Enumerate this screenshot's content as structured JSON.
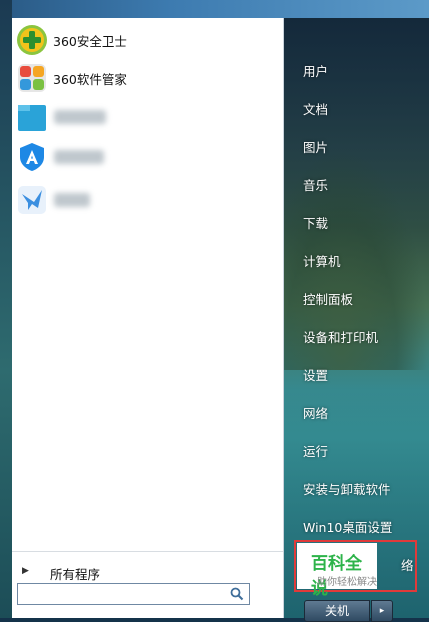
{
  "apps": [
    {
      "label": "360安全卫士",
      "icon": "360-safe-guard-icon"
    },
    {
      "label": "360软件管家",
      "icon": "360-software-manager-icon"
    }
  ],
  "all_programs": {
    "label": "所有程序"
  },
  "search": {
    "placeholder": "",
    "value": ""
  },
  "right_menu": [
    "用户",
    "文档",
    "图片",
    "音乐",
    "下载",
    "计算机",
    "控制面板",
    "设备和打印机",
    "设置",
    "网络",
    "运行",
    "安装与卸载软件",
    "Win10桌面设置"
  ],
  "right_menu_partial": "络",
  "shutdown": {
    "label": "关机",
    "arrow": "▸"
  },
  "watermark": {
    "title": "百科全说",
    "subtitle": "助你轻松解决"
  },
  "colors": {
    "accent_green": "#2db34a",
    "highlight_red": "#e03a3a"
  }
}
